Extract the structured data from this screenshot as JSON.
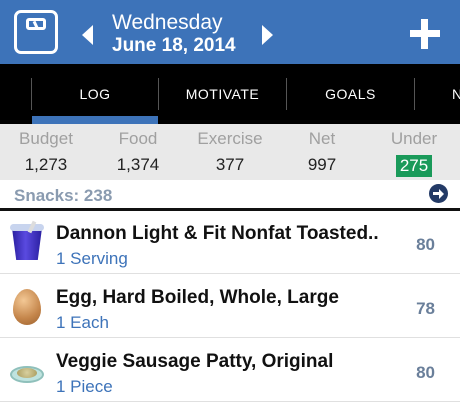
{
  "header": {
    "day": "Wednesday",
    "date": "June 18, 2014",
    "icons": {
      "scale": "scale-icon",
      "prev": "arrow-left-icon",
      "next": "arrow-right-icon",
      "add": "plus-icon"
    },
    "bg_color": "#3d73b9"
  },
  "tabs": [
    {
      "label": "LOG",
      "active": true
    },
    {
      "label": "MOTIVATE",
      "active": false
    },
    {
      "label": "GOALS",
      "active": false
    },
    {
      "label": "N",
      "active": false
    }
  ],
  "summary": {
    "budget": {
      "label": "Budget",
      "value": "1,273"
    },
    "food": {
      "label": "Food",
      "value": "1,374"
    },
    "exercise": {
      "label": "Exercise",
      "value": "377"
    },
    "net": {
      "label": "Net",
      "value": "997"
    },
    "under": {
      "label": "Under",
      "value": "275",
      "color": "#1a9a5a"
    }
  },
  "section": {
    "title": "Snacks: 238",
    "icon": "arrow-circle-right-icon"
  },
  "entries": [
    {
      "name": "Dannon Light & Fit Nonfat Toasted..",
      "serving": "1 Serving",
      "calories": "80",
      "icon": "yogurt-cup-icon"
    },
    {
      "name": "Egg, Hard Boiled, Whole, Large",
      "serving": "1 Each",
      "calories": "78",
      "icon": "egg-icon"
    },
    {
      "name": "Veggie Sausage Patty, Original",
      "serving": "1 Piece",
      "calories": "80",
      "icon": "patty-plate-icon"
    }
  ]
}
